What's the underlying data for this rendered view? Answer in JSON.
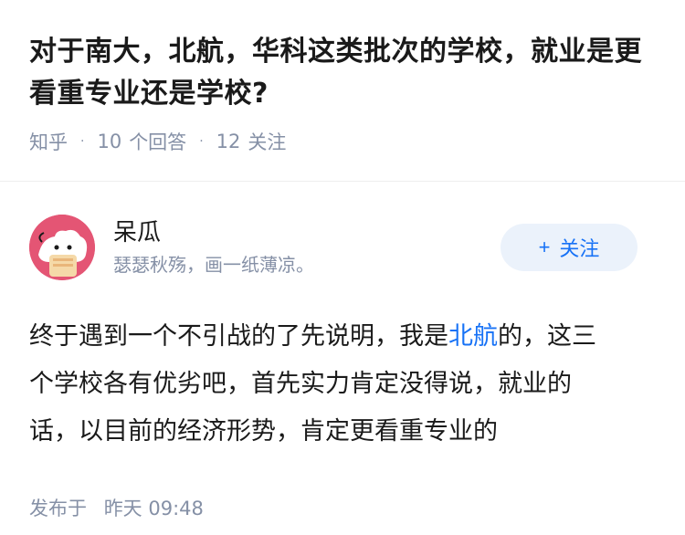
{
  "question": {
    "title": "对于南大，北航，华科这类批次的学校，就业是更看重专业还是学校?",
    "source": "知乎",
    "answer_count": "10",
    "answer_label": "个回答",
    "follow_count": "12",
    "follow_label": "关注"
  },
  "author": {
    "name": "呆瓜",
    "bio": "瑟瑟秋殇，画一纸薄凉。",
    "follow_button": "关注",
    "follow_plus": "+"
  },
  "answer": {
    "text_before_link": "终于遇到一个不引战的了先说明，我是",
    "link_text": "北航",
    "text_after_link": "的，这三个学校各有优劣吧，首先实力肯定没得说，就业的话，以目前的经济形势，肯定更看重专业的"
  },
  "publish": {
    "label": "发布于",
    "time": "昨天 09:48"
  },
  "colors": {
    "accent": "#1772f6",
    "meta": "#8590a6",
    "avatar_bg": "#e45574"
  }
}
